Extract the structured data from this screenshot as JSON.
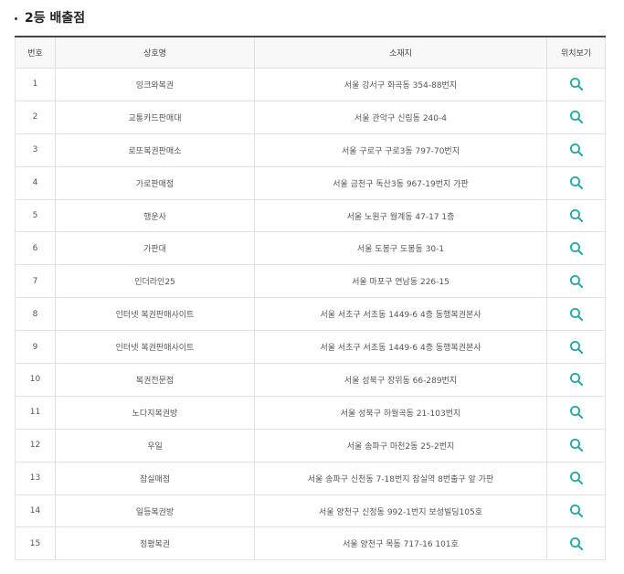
{
  "section": {
    "title": "2등 배출점"
  },
  "table": {
    "headers": [
      "번호",
      "상호명",
      "소재지",
      "위치보기"
    ],
    "rows": [
      {
        "no": "1",
        "name": "잉크와복권",
        "address": "서울 강서구 화곡동 354-88번지"
      },
      {
        "no": "2",
        "name": "교통카드판매대",
        "address": "서울 관악구 신림동 240-4"
      },
      {
        "no": "3",
        "name": "로또복권판매소",
        "address": "서울 구로구 구로3동 797-70번지"
      },
      {
        "no": "4",
        "name": "가로판매점",
        "address": "서울 금천구 독산3동 967-19번지 가판"
      },
      {
        "no": "5",
        "name": "행운사",
        "address": "서울 노원구 월계동 47-17 1층"
      },
      {
        "no": "6",
        "name": "가판대",
        "address": "서울 도봉구 도봉동 30-1"
      },
      {
        "no": "7",
        "name": "인더라인25",
        "address": "서울 마포구 연남동 226-15"
      },
      {
        "no": "8",
        "name": "인터넷 복권판매사이트",
        "address": "서울 서초구 서초동 1449-6 4층 동행복권본사"
      },
      {
        "no": "9",
        "name": "인터넷 복권판매사이트",
        "address": "서울 서초구 서초동 1449-6 4층 동행복권본사"
      },
      {
        "no": "10",
        "name": "복권전문점",
        "address": "서울 성북구 장위동 66-289번지"
      },
      {
        "no": "11",
        "name": "노다지복권방",
        "address": "서울 성북구 하월곡동 21-103번지"
      },
      {
        "no": "12",
        "name": "우일",
        "address": "서울 송파구 마천2동 25-2번지"
      },
      {
        "no": "13",
        "name": "잠실매점",
        "address": "서울 송파구 신천동 7-18번지 잠실역 8번출구 앞 가판"
      },
      {
        "no": "14",
        "name": "일등복권방",
        "address": "서울 양천구 신정동 992-1번지 보성빌딩105호"
      },
      {
        "no": "15",
        "name": "정평복권",
        "address": "서울 양천구 목동 717-16 101호"
      }
    ]
  },
  "icons": {
    "search": "search-icon",
    "color": "#1fa8a0"
  }
}
